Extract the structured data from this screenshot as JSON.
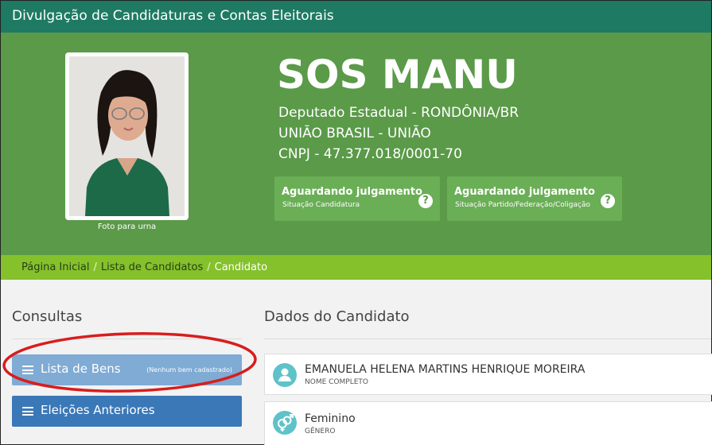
{
  "header": {
    "title": "Divulgação de Candidaturas e Contas Eleitorais"
  },
  "candidate": {
    "photo_caption": "Foto para urna",
    "name": "SOS MANU",
    "office": "Deputado Estadual - RONDÔNIA/BR",
    "party": "UNIÃO BRASIL - UNIÃO",
    "cnpj": "CNPJ - 47.377.018/0001-70"
  },
  "status_cards": [
    {
      "title": "Aguardando julgamento",
      "subtitle": "Situação Candidatura",
      "icon": "question-circle-icon"
    },
    {
      "title": "Aguardando julgamento",
      "subtitle": "Situação Partido/Federação/Coligação",
      "icon": "question-circle-icon"
    }
  ],
  "breadcrumb": {
    "items": [
      "Página Inicial",
      "Lista de Candidatos"
    ],
    "current": "Candidato"
  },
  "sidebar": {
    "title": "Consultas",
    "buttons": [
      {
        "label": "Lista de Bens",
        "note": "(Nenhum bem cadastrado)",
        "icon": "list-icon"
      },
      {
        "label": "Eleições Anteriores",
        "icon": "list-icon"
      }
    ]
  },
  "main": {
    "title": "Dados do Candidato",
    "fields": [
      {
        "value": "EMANUELA HELENA MARTINS HENRIQUE MOREIRA",
        "label": "NOME COMPLETO",
        "icon": "user-icon"
      },
      {
        "value": "Feminino",
        "label": "GÊNERO",
        "icon": "gender-icon"
      }
    ]
  },
  "colors": {
    "topbar": "#1f7a63",
    "hero": "#5a9a48",
    "breadcrumb": "#84c12b",
    "button_light": "#7fabd4",
    "button_dark": "#3a78b8",
    "annotation": "#d81d1d",
    "icon_circle": "#5fc2c9"
  }
}
